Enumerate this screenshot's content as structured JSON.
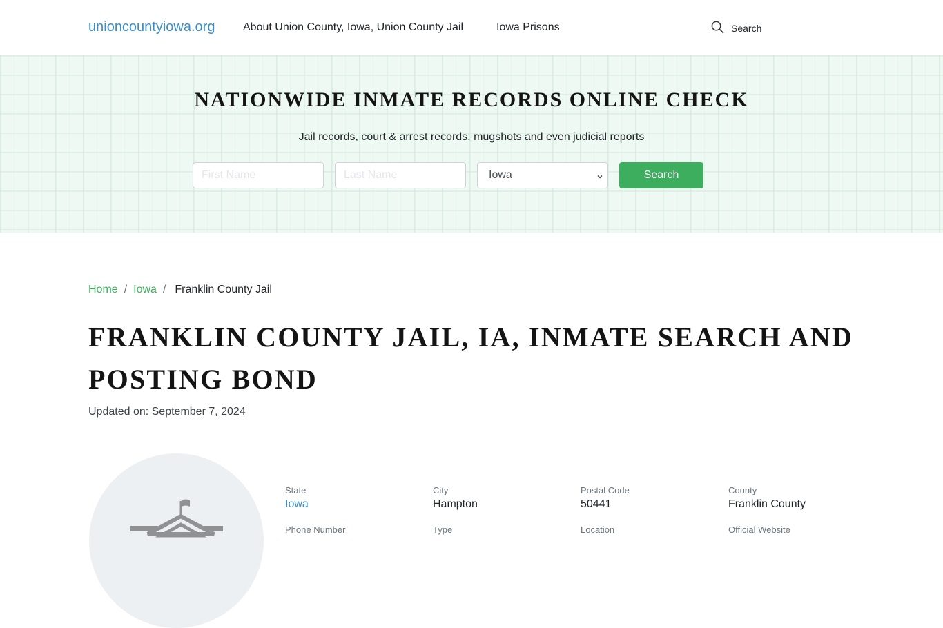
{
  "nav": {
    "brand": "unioncountyiowa.org",
    "links": [
      "About Union County, Iowa, Union County Jail",
      "Iowa Prisons"
    ],
    "search_label": "Search",
    "search_icon": "magnifier"
  },
  "hero": {
    "title": "NATIONWIDE INMATE RECORDS ONLINE CHECK",
    "subtitle": "Jail records, court & arrest records, mugshots and even judicial reports",
    "first_name_placeholder": "First Name",
    "last_name_placeholder": "Last Name",
    "state_selected": "Iowa",
    "search_button": "Search",
    "accent_color": "#3cae5e"
  },
  "breadcrumb": {
    "items": [
      "Home",
      "Iowa"
    ],
    "current": "Franklin County Jail",
    "separator": "/"
  },
  "page": {
    "title": "FRANKLIN COUNTY JAIL, IA, INMATE SEARCH AND POSTING BOND",
    "updated": "Updated on: September 7, 2024",
    "image_icon": "jail-building-with-flag"
  },
  "info": [
    {
      "label": "State",
      "value": "Iowa",
      "link": true
    },
    {
      "label": "City",
      "value": "Hampton",
      "link": false
    },
    {
      "label": "Postal Code",
      "value": "50441",
      "link": false
    },
    {
      "label": "County",
      "value": "Franklin County",
      "link": false
    },
    {
      "label": "Phone Number",
      "value": "",
      "link": false
    },
    {
      "label": "Type",
      "value": "",
      "link": false
    },
    {
      "label": "Location",
      "value": "",
      "link": false
    },
    {
      "label": "Official Website",
      "value": "",
      "link": false
    }
  ]
}
